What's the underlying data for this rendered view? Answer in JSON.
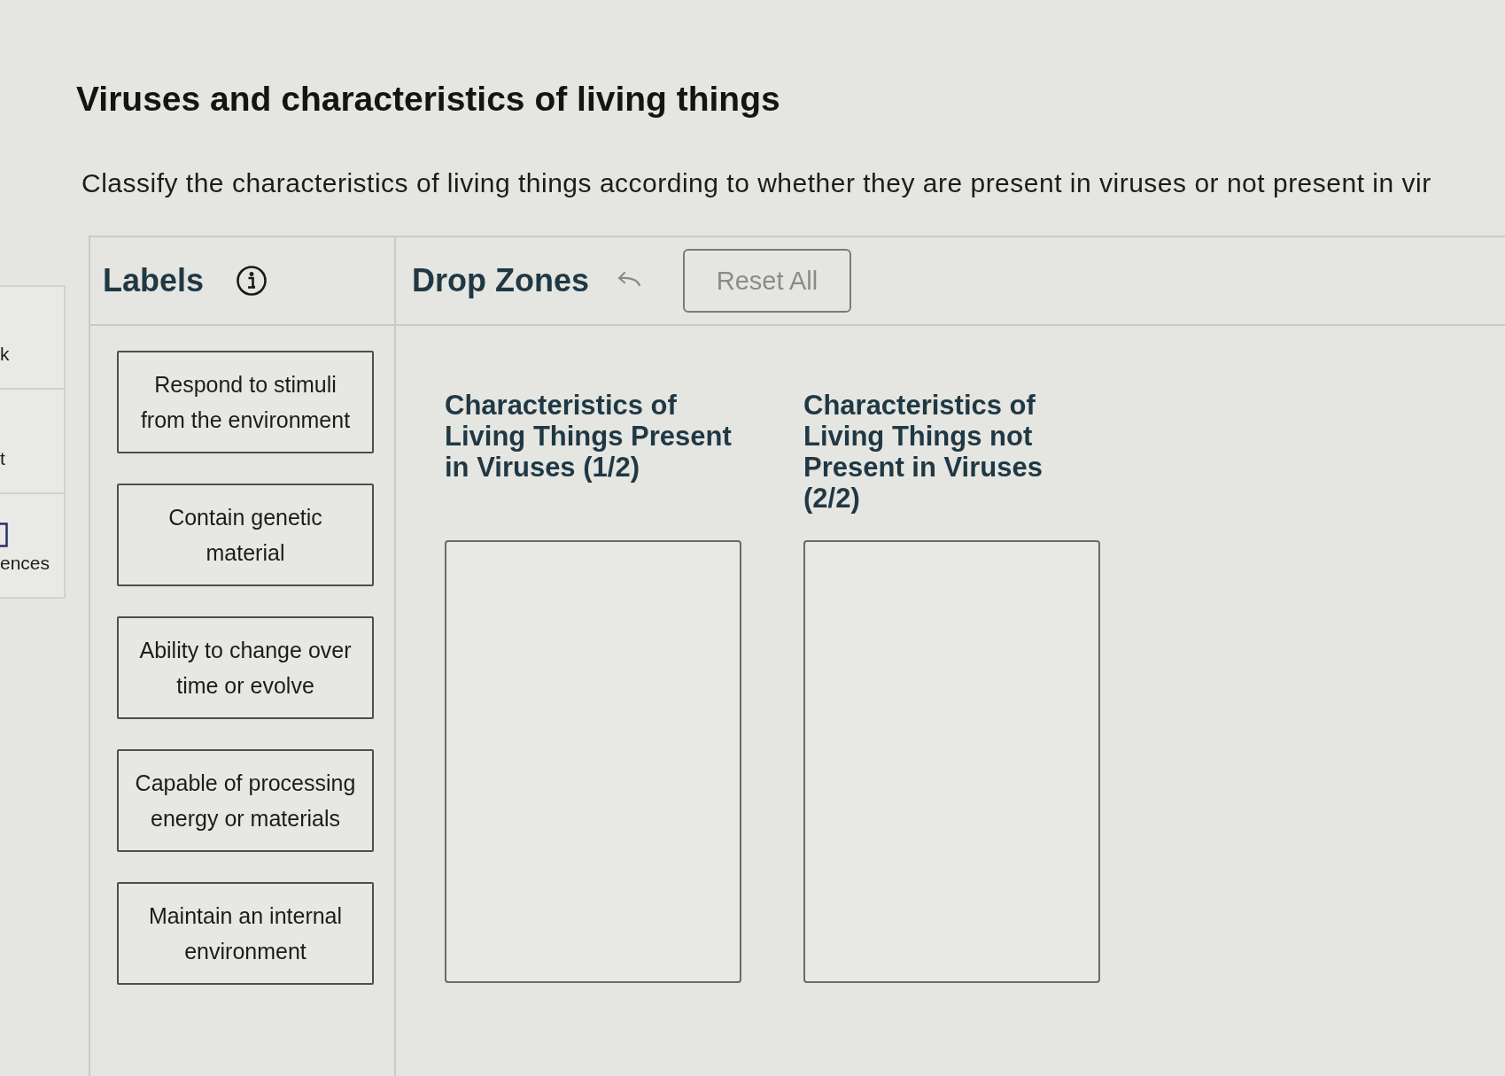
{
  "sidebar": {
    "items": [
      {
        "kind": "text",
        "label": "k"
      },
      {
        "kind": "text",
        "label": "t"
      },
      {
        "kind": "icon",
        "label": "ences"
      }
    ]
  },
  "title": "Viruses and characteristics of living things",
  "instruction": "Classify the characteristics of living things according to whether they are present in viruses or not present in vir",
  "labels_panel": {
    "heading": "Labels",
    "labels": [
      "Respond to stimuli from the environment",
      "Contain genetic material",
      "Ability to change over time or evolve",
      "Capable of processing energy or materials",
      "Maintain an internal environment"
    ]
  },
  "drop_zones_panel": {
    "heading": "Drop Zones",
    "reset_button": "Reset All",
    "zones": [
      {
        "heading": "Characteristics of Living Things Present in Viruses (1/2)"
      },
      {
        "heading": "Characteristics of Living Things not Present in Viruses (2/2)"
      }
    ]
  }
}
